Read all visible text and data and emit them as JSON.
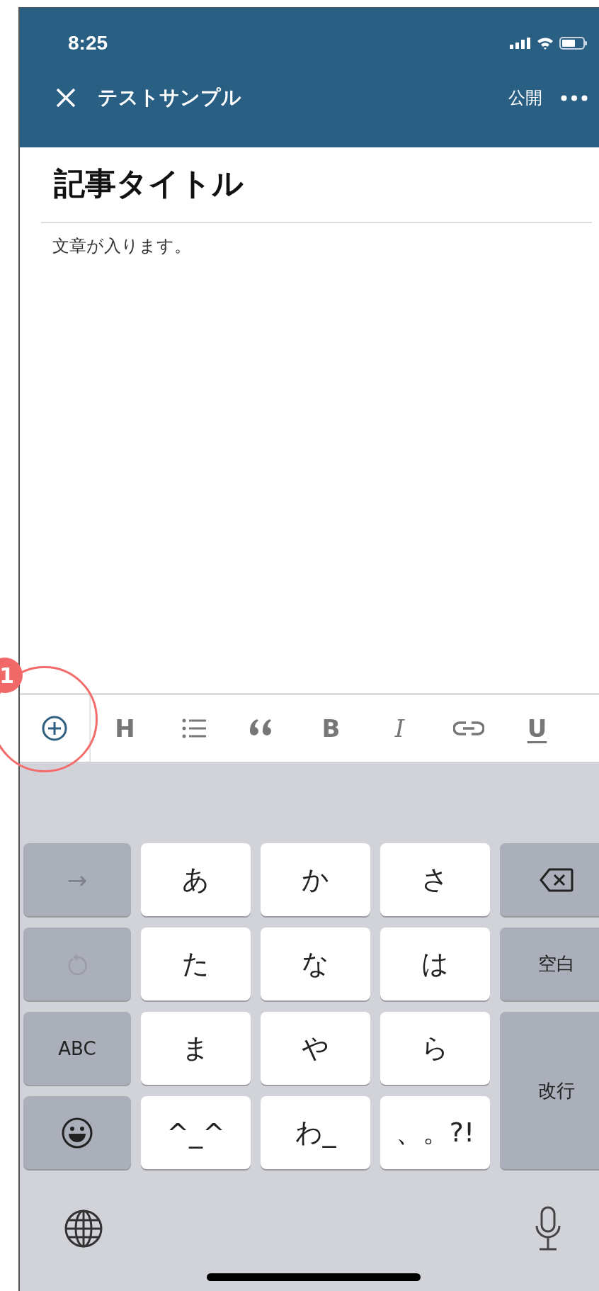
{
  "status_bar": {
    "time": "8:25"
  },
  "nav": {
    "title": "テストサンプル",
    "publish": "公開"
  },
  "article": {
    "title": "記事タイトル",
    "body": "文章が入ります。"
  },
  "toolbar": [
    {
      "kind": "add"
    },
    {
      "kind": "heading",
      "label": "H"
    },
    {
      "kind": "list"
    },
    {
      "kind": "quote"
    },
    {
      "kind": "bold",
      "label": "B"
    },
    {
      "kind": "italic",
      "label": "I"
    },
    {
      "kind": "link"
    },
    {
      "kind": "underline",
      "label": "U"
    }
  ],
  "keyboard": {
    "rows": [
      [
        {
          "kind": "char",
          "label": "→"
        },
        {
          "kind": "kana",
          "label": "あ"
        },
        {
          "kind": "kana",
          "label": "か"
        },
        {
          "kind": "kana",
          "label": "さ"
        },
        {
          "kind": "backspace"
        }
      ],
      [
        {
          "kind": "undo"
        },
        {
          "kind": "kana",
          "label": "た"
        },
        {
          "kind": "kana",
          "label": "な"
        },
        {
          "kind": "kana",
          "label": "は"
        },
        {
          "kind": "func",
          "label": "空白"
        }
      ],
      [
        {
          "kind": "func",
          "label": "ABC"
        },
        {
          "kind": "kana",
          "label": "ま"
        },
        {
          "kind": "kana",
          "label": "や"
        },
        {
          "kind": "kana",
          "label": "ら"
        },
        {
          "kind": "enter",
          "label": "改行"
        }
      ],
      [
        {
          "kind": "emoji"
        },
        {
          "kind": "kana",
          "label": "^_^"
        },
        {
          "kind": "kana",
          "label": "わ_"
        },
        {
          "kind": "kana",
          "label": "、。?!"
        }
      ]
    ]
  },
  "annotation": {
    "number": "1"
  }
}
